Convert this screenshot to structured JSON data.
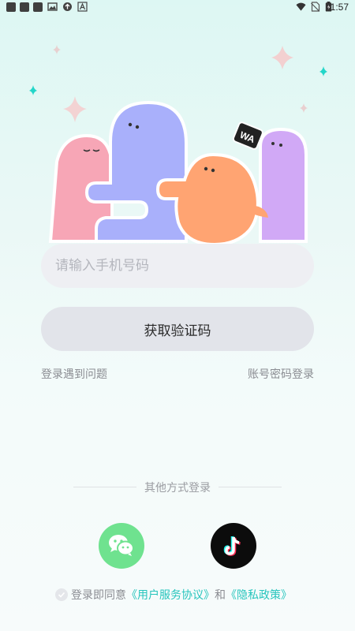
{
  "status_bar": {
    "time": "1:57"
  },
  "login": {
    "phone_placeholder": "请输入手机号码",
    "get_code_label": "获取验证码",
    "trouble_link": "登录遇到问题",
    "password_login_link": "账号密码登录"
  },
  "other_login": {
    "divider_text": "其他方式登录",
    "providers": [
      "wechat-icon",
      "douyin-icon"
    ]
  },
  "agreement": {
    "prefix": "登录即同意",
    "user_agreement": "《用户服务协议》",
    "and": "和",
    "privacy_policy": "《隐私政策》"
  },
  "hero": {
    "badge_text": "WA"
  },
  "colors": {
    "accent": "#27c5bd",
    "wechat": "#6fe28f",
    "douyin": "#0c0c0c",
    "mascot_pink": "#f7a6b6",
    "mascot_blue": "#a9b0fb",
    "mascot_orange": "#ffa472",
    "mascot_purple": "#d1a9f6"
  }
}
